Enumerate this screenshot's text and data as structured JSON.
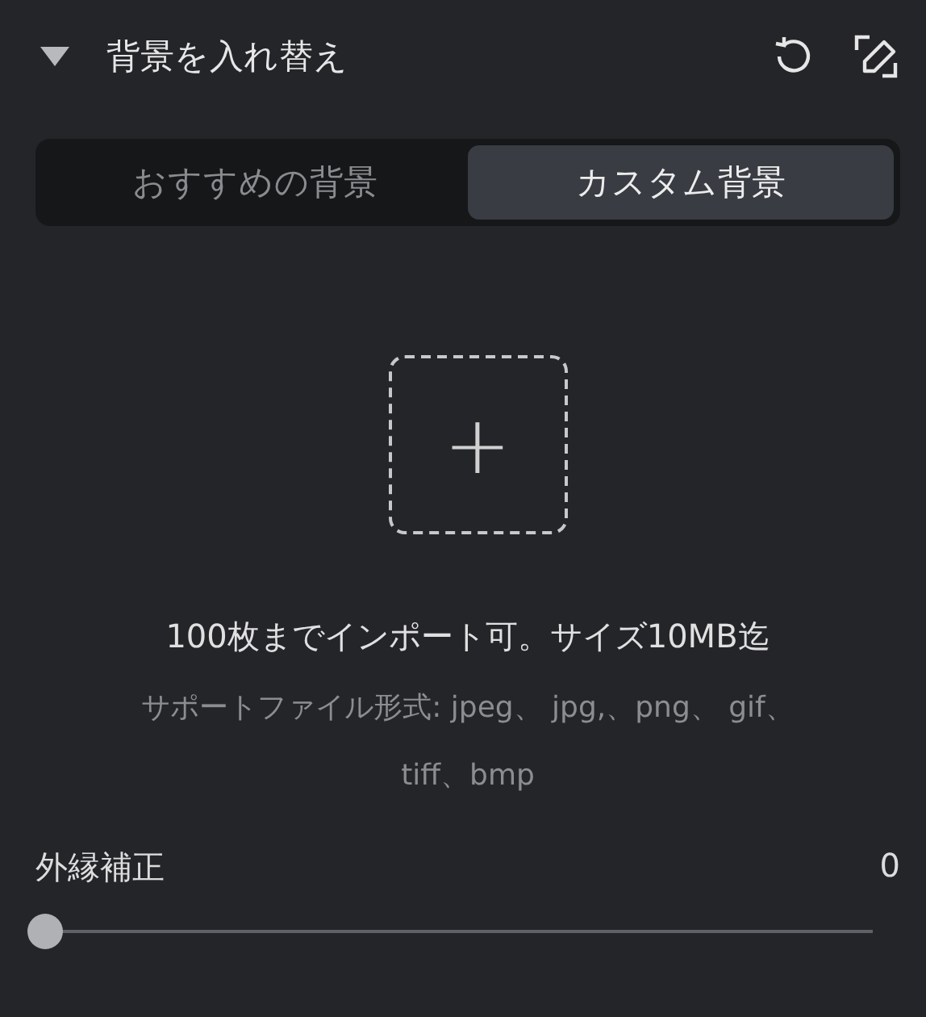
{
  "section": {
    "title": "背景を入れ替え",
    "expanded": true
  },
  "tabs": [
    {
      "label": "おすすめの背景",
      "selected": false
    },
    {
      "label": "カスタム背景",
      "selected": true
    }
  ],
  "upload": {
    "plus": "+",
    "limit_text": "100枚までインポート可。サイズ10MB迄",
    "formats_text": "サポートファイル形式: jpeg、 jpg,、png、 gif、 tiff、bmp"
  },
  "slider": {
    "label": "外縁補正",
    "reading": "0",
    "level": 0
  }
}
